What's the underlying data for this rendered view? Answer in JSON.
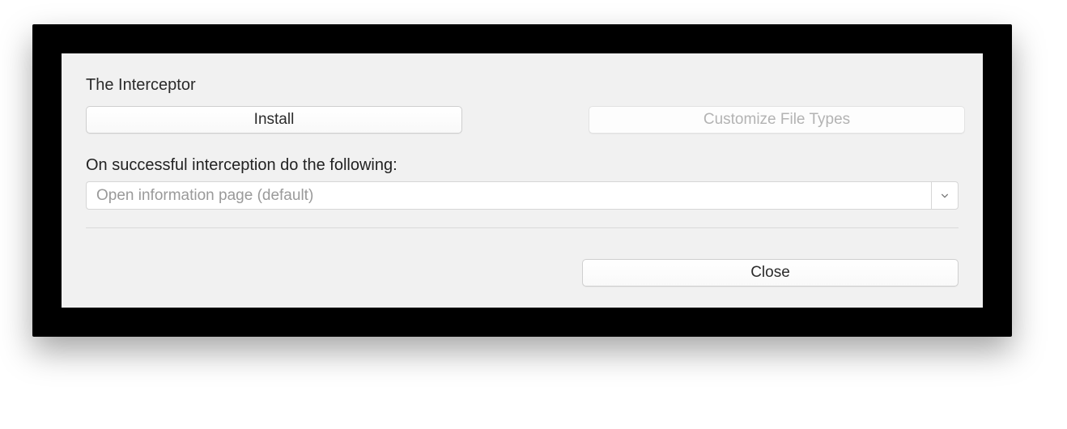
{
  "title": "The Interceptor",
  "buttons": {
    "install": "Install",
    "customize": "Customize File Types",
    "close": "Close"
  },
  "action_label": "On successful interception do the following:",
  "dropdown": {
    "selected": "Open information page (default)"
  }
}
